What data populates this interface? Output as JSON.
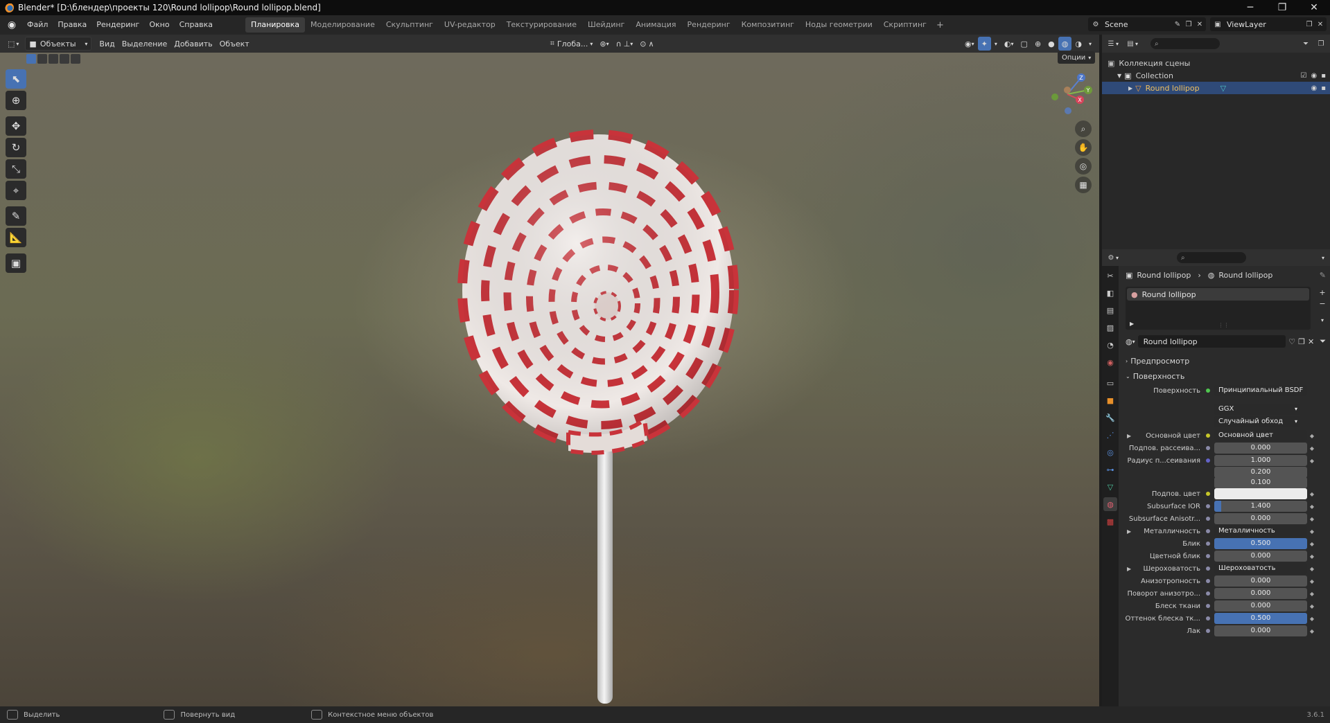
{
  "window": {
    "title": "Blender* [D:\\блендер\\проекты 120\\Round lollipop\\Round lollipop.blend]",
    "minimize": "─",
    "maximize": "❐",
    "close": "✕"
  },
  "menu": {
    "items": [
      "Файл",
      "Правка",
      "Рендеринг",
      "Окно",
      "Справка"
    ],
    "workspaces": [
      "Планировка",
      "Моделирование",
      "Скульптинг",
      "UV-редактор",
      "Текстурирование",
      "Шейдинг",
      "Анимация",
      "Рендеринг",
      "Композитинг",
      "Ноды геометрии",
      "Скриптинг"
    ],
    "active_workspace": 0,
    "add_tab": "+",
    "scene": "Scene",
    "view_layer": "ViewLayer"
  },
  "viewport_header": {
    "mode": "Объекты",
    "menus": [
      "Вид",
      "Выделение",
      "Добавить",
      "Объект"
    ],
    "transform_orientation": "Глоба...",
    "options": "Опции"
  },
  "gizmo": {
    "x": "X",
    "y": "Y",
    "z": "Z"
  },
  "outliner": {
    "scene_collection": "Коллекция сцены",
    "collection": "Collection",
    "object": "Round lollipop"
  },
  "properties": {
    "breadcrumb_object": "Round lollipop",
    "breadcrumb_material": "Round lollipop",
    "material_slot": "Round lollipop",
    "material_name": "Round lollipop",
    "panels": {
      "preview": "Предпросмотр",
      "surface": "Поверхность"
    },
    "surface_label": "Поверхность",
    "surface_shader": "Принципиальный BSDF",
    "distribution": "GGX",
    "subsurface_method": "Случайный обход",
    "rows": [
      {
        "label": "Основной цвет",
        "type": "link",
        "value": "Основной цвет",
        "socket": "#c7c729",
        "expand": true
      },
      {
        "label": "Подпов. рассеива...",
        "type": "num",
        "value": "0.000",
        "socket": "#8a8aa8"
      },
      {
        "label": "Радиус п...сеивания",
        "type": "num",
        "value": "1.000",
        "socket": "#6363c7"
      },
      {
        "label": "",
        "type": "num",
        "value": "0.200",
        "socket": ""
      },
      {
        "label": "",
        "type": "num",
        "value": "0.100",
        "socket": ""
      },
      {
        "label": "Подпов. цвет",
        "type": "color",
        "value": "",
        "socket": "#c7c729"
      },
      {
        "label": "Subsurface IOR",
        "type": "num",
        "value": "1.400",
        "socket": "#8a8aa8",
        "fill": 0.1
      },
      {
        "label": "Subsurface Anisotr...",
        "type": "num",
        "value": "0.000",
        "socket": "#8a8aa8"
      },
      {
        "label": "Металличность",
        "type": "link",
        "value": "Металличность",
        "socket": "#8a8aa8",
        "expand": true
      },
      {
        "label": "Блик",
        "type": "num",
        "value": "0.500",
        "socket": "#8a8aa8",
        "fill": 1.0
      },
      {
        "label": "Цветной блик",
        "type": "num",
        "value": "0.000",
        "socket": "#8a8aa8"
      },
      {
        "label": "Шероховатость",
        "type": "link",
        "value": "Шероховатость",
        "socket": "#8a8aa8",
        "expand": true
      },
      {
        "label": "Анизотропность",
        "type": "num",
        "value": "0.000",
        "socket": "#8a8aa8"
      },
      {
        "label": "Поворот анизотро...",
        "type": "num",
        "value": "0.000",
        "socket": "#8a8aa8"
      },
      {
        "label": "Блеск ткани",
        "type": "num",
        "value": "0.000",
        "socket": "#8a8aa8"
      },
      {
        "label": "Оттенок блеска тк...",
        "type": "num",
        "value": "0.500",
        "socket": "#8a8aa8",
        "fill": 1.0
      },
      {
        "label": "Лак",
        "type": "num",
        "value": "0.000",
        "socket": "#8a8aa8"
      }
    ]
  },
  "status": {
    "select": "Выделить",
    "rotate": "Повернуть вид",
    "context": "Контекстное меню объектов",
    "version": "3.6.1"
  },
  "colors": {
    "accent": "#4772b3",
    "candy_red": "#c8333a",
    "candy_white": "#efe9e6"
  }
}
